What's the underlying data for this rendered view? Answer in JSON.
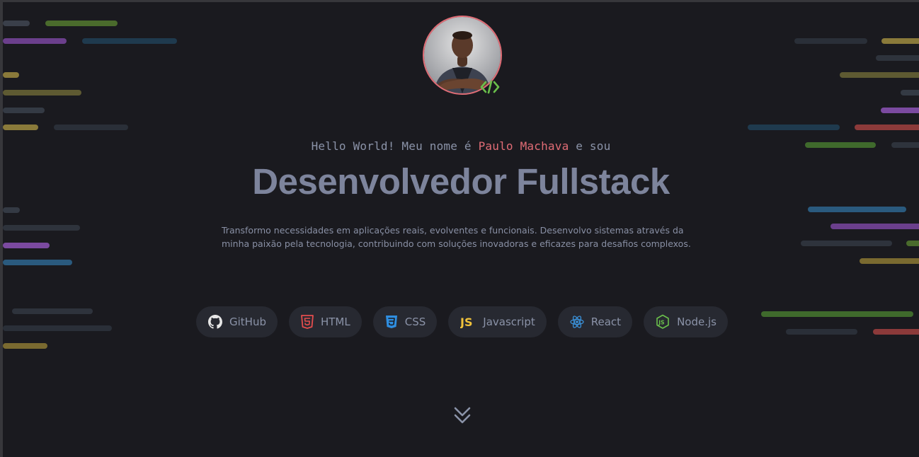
{
  "hero": {
    "greeting_prefix": "Hello World! Meu nome é ",
    "name": "Paulo Machava",
    "greeting_suffix": " e sou",
    "title": "Desenvolvedor Fullstack",
    "description": "Transformo necessidades em aplicações reais, evolventes e funcionais. Desenvolvo sistemas através da minha paixão pela tecnologia, contribuindo com soluções inovadoras e eficazes para desafios complexos."
  },
  "avatar": {
    "icon": "profile-photo",
    "badge_icon": "code-brackets-icon",
    "ring_color": "#e06c75",
    "badge_color": "#6abf4b"
  },
  "tech": [
    {
      "label": "GitHub",
      "icon": "github-icon",
      "color": "#e6e6e6"
    },
    {
      "label": "HTML",
      "icon": "html5-icon",
      "color": "#e44d4d"
    },
    {
      "label": "CSS",
      "icon": "css3-icon",
      "color": "#2f8ee0"
    },
    {
      "label": "Javascript",
      "icon": "javascript-icon",
      "color": "#f0c23b"
    },
    {
      "label": "React",
      "icon": "react-icon",
      "color": "#3a8fd6"
    },
    {
      "label": "Node.js",
      "icon": "nodejs-icon",
      "color": "#6abf4b"
    }
  ],
  "scroll": {
    "icon": "double-chevron-down-icon",
    "color": "#8b93a8"
  },
  "colors": {
    "background": "#1a1a1f",
    "accent": "#e06c75",
    "text": "#8b93a8",
    "pill": "#272931"
  }
}
